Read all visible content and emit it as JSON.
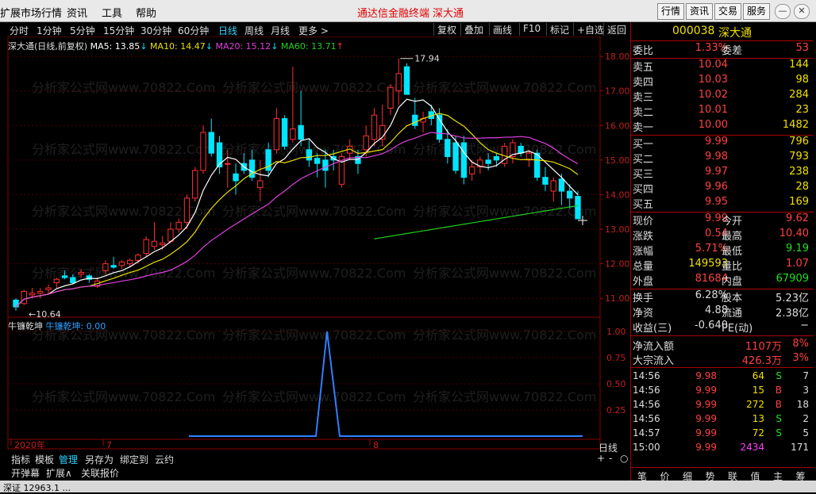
{
  "menu": {
    "items": [
      "扩展市场行情",
      "资讯",
      "工具",
      "帮助"
    ],
    "brand": "通达信金融终端",
    "stock": "深大通",
    "buttons": [
      "行情",
      "资讯",
      "交易",
      "服务"
    ]
  },
  "toolbar": {
    "periods": [
      "分时",
      "1分钟",
      "5分钟",
      "15分钟",
      "30分钟",
      "60分钟",
      "日线",
      "周线",
      "月线",
      "更多 >"
    ],
    "active": "日线",
    "right": [
      "复权",
      "叠加",
      "画线",
      "F10",
      "标记",
      "+自选",
      "返回"
    ]
  },
  "legend": {
    "name": "深大通(日线,前复权)",
    "ma5": "MA5: 13.85",
    "ma10": "MA10: 14.47",
    "ma20": "MA20: 15.12",
    "ma60": "MA60: 13.71"
  },
  "indicator": {
    "name": "牛镰乾坤",
    "label": "牛镰乾坤: 0.00"
  },
  "axis": {
    "period": "日线",
    "date_left": "2020年",
    "date_m1": "7",
    "date_m2": "8"
  },
  "watermark": "分析家公式网www.70822.Com",
  "bottom_tabs": [
    "指标",
    "模板",
    "管理",
    "另存为",
    "绑定到",
    "云约"
  ],
  "bottom_tabs2": [
    "开弹幕",
    "扩展∧",
    "关联报价"
  ],
  "zoom": [
    "+",
    "-",
    "○"
  ],
  "colors": {
    "up": "#ff3030",
    "down": "#00e5ff",
    "ma5": "#ffffff",
    "ma10": "#e8e000",
    "ma20": "#e040e0",
    "ma60": "#20d020",
    "ind": "#2f7fff"
  },
  "chart_data": {
    "type": "candlestick",
    "ylim": [
      10.5,
      18.3
    ],
    "y_ticks": [
      11.0,
      12.0,
      13.0,
      14.0,
      15.0,
      16.0,
      17.0,
      18.0
    ],
    "ind_ticks": [
      0.25,
      0.5,
      0.75,
      1.0
    ],
    "annotations": {
      "high": "17.94",
      "low": "10.64"
    },
    "candles": [
      [
        10.95,
        11.0,
        10.64,
        10.75
      ],
      [
        10.85,
        11.25,
        10.8,
        11.2
      ],
      [
        11.1,
        11.3,
        11.0,
        11.15
      ],
      [
        11.15,
        11.3,
        11.0,
        11.2
      ],
      [
        11.25,
        11.4,
        11.1,
        11.3
      ],
      [
        11.45,
        11.6,
        11.3,
        11.55
      ],
      [
        11.65,
        11.8,
        11.55,
        11.6
      ],
      [
        11.6,
        11.7,
        11.4,
        11.45
      ],
      [
        11.7,
        11.85,
        11.6,
        11.75
      ],
      [
        11.65,
        11.7,
        11.45,
        11.55
      ],
      [
        11.35,
        11.6,
        11.3,
        11.5
      ],
      [
        11.8,
        12.1,
        11.7,
        12.0
      ],
      [
        11.95,
        12.2,
        11.85,
        11.9
      ],
      [
        11.95,
        12.1,
        11.85,
        12.05
      ],
      [
        12.0,
        12.15,
        11.9,
        12.1
      ],
      [
        12.1,
        12.3,
        12.0,
        12.25
      ],
      [
        12.3,
        12.8,
        12.2,
        12.7
      ],
      [
        12.5,
        13.2,
        12.4,
        12.65
      ],
      [
        12.55,
        12.8,
        12.4,
        12.6
      ],
      [
        12.65,
        13.2,
        12.6,
        13.0
      ],
      [
        13.0,
        13.3,
        12.9,
        13.2
      ],
      [
        13.2,
        14.0,
        13.0,
        13.9
      ],
      [
        13.9,
        14.8,
        13.8,
        14.7
      ],
      [
        14.7,
        16.0,
        14.6,
        15.8
      ],
      [
        15.8,
        16.2,
        15.1,
        15.2
      ],
      [
        15.5,
        15.7,
        14.6,
        14.8
      ],
      [
        14.9,
        15.3,
        14.2,
        14.9
      ],
      [
        14.6,
        14.9,
        14.0,
        14.4
      ],
      [
        14.9,
        15.2,
        14.6,
        14.7
      ],
      [
        15.0,
        15.3,
        14.4,
        14.5
      ],
      [
        14.2,
        15.0,
        13.8,
        14.4
      ],
      [
        15.3,
        15.5,
        14.5,
        14.7
      ],
      [
        15.3,
        16.5,
        15.2,
        16.2
      ],
      [
        16.2,
        16.3,
        15.3,
        15.4
      ],
      [
        15.6,
        17.7,
        15.5,
        15.9
      ],
      [
        16.0,
        17.0,
        15.4,
        15.6
      ],
      [
        15.3,
        15.6,
        14.8,
        15.0
      ],
      [
        15.05,
        15.2,
        14.5,
        14.9
      ],
      [
        15.0,
        15.3,
        14.2,
        14.7
      ],
      [
        15.1,
        15.3,
        14.7,
        15.0
      ],
      [
        14.3,
        15.2,
        14.2,
        15.1
      ],
      [
        15.2,
        15.6,
        15.0,
        15.4
      ],
      [
        15.1,
        15.3,
        14.6,
        14.9
      ],
      [
        15.3,
        16.0,
        15.1,
        15.7
      ],
      [
        15.6,
        16.5,
        15.4,
        16.3
      ],
      [
        15.6,
        16.6,
        15.4,
        16.0
      ],
      [
        16.5,
        17.2,
        16.3,
        17.1
      ],
      [
        17.0,
        17.94,
        16.6,
        17.5
      ],
      [
        17.7,
        17.8,
        16.9,
        16.9
      ],
      [
        16.3,
        16.8,
        15.9,
        16.0
      ],
      [
        16.1,
        16.4,
        15.8,
        16.2
      ],
      [
        16.4,
        16.6,
        16.0,
        16.2
      ],
      [
        16.3,
        16.5,
        15.5,
        15.6
      ],
      [
        15.6,
        15.9,
        14.9,
        15.1
      ],
      [
        15.5,
        15.7,
        14.6,
        14.7
      ],
      [
        15.5,
        15.7,
        14.3,
        14.5
      ],
      [
        14.6,
        15.0,
        14.4,
        14.8
      ],
      [
        14.8,
        15.1,
        14.6,
        15.0
      ],
      [
        15.0,
        15.2,
        14.7,
        14.9
      ],
      [
        15.1,
        15.2,
        14.8,
        15.0
      ],
      [
        14.9,
        15.5,
        14.8,
        15.4
      ],
      [
        15.1,
        15.6,
        14.9,
        15.5
      ],
      [
        15.4,
        15.5,
        15.1,
        15.2
      ],
      [
        15.0,
        15.3,
        14.8,
        15.2
      ],
      [
        15.2,
        15.3,
        14.4,
        14.5
      ],
      [
        14.5,
        14.8,
        14.1,
        14.3
      ],
      [
        14.1,
        14.5,
        13.8,
        14.4
      ],
      [
        14.45,
        14.6,
        13.7,
        14.1
      ],
      [
        14.1,
        14.3,
        13.6,
        13.9
      ],
      [
        13.95,
        14.1,
        13.3,
        13.3
      ]
    ],
    "ma5_start": 0,
    "ma10_start": 0,
    "ma20_start": 0,
    "ma60_start": 44
  },
  "panel": {
    "code": "000038",
    "name": "深大通",
    "weibi": {
      "l": "委比",
      "v": "1.33%",
      "l2": "委差",
      "v2": "53"
    },
    "sells": [
      {
        "l": "卖五",
        "p": "10.04",
        "q": "144"
      },
      {
        "l": "卖四",
        "p": "10.03",
        "q": "98"
      },
      {
        "l": "卖三",
        "p": "10.02",
        "q": "284"
      },
      {
        "l": "卖二",
        "p": "10.01",
        "q": "23"
      },
      {
        "l": "卖一",
        "p": "10.00",
        "q": "1482"
      }
    ],
    "buys": [
      {
        "l": "买一",
        "p": "9.99",
        "q": "796"
      },
      {
        "l": "买二",
        "p": "9.98",
        "q": "793"
      },
      {
        "l": "买三",
        "p": "9.97",
        "q": "238"
      },
      {
        "l": "买四",
        "p": "9.96",
        "q": "28"
      },
      {
        "l": "买五",
        "p": "9.95",
        "q": "169"
      }
    ],
    "stats": [
      {
        "l": "现价",
        "v": "9.99",
        "l2": "今开",
        "v2": "9.62"
      },
      {
        "l": "涨跌",
        "v": "0.54",
        "l2": "最高",
        "v2": "10.40"
      },
      {
        "l": "涨幅",
        "v": "5.71%",
        "l2": "最低",
        "v2": "9.19"
      },
      {
        "l": "总量",
        "v": "149593",
        "l2": "量比",
        "v2": "1.07"
      },
      {
        "l": "外盘",
        "v": "81684",
        "l2": "内盘",
        "v2": "67909"
      }
    ],
    "stats2": [
      {
        "l": "换手",
        "v": "6.28%",
        "l2": "股本",
        "v2": "5.23亿"
      },
      {
        "l": "净资",
        "v": "4.88",
        "l2": "流通",
        "v2": "2.38亿"
      },
      {
        "l": "收益(三)",
        "v": "-0.640",
        "l2": "PE(动)",
        "v2": "−"
      }
    ],
    "flow": [
      {
        "l": "净流入额",
        "v": "1107万",
        "p": "8%"
      },
      {
        "l": "大宗流入",
        "v": "426.3万",
        "p": "3%"
      }
    ],
    "ticks": [
      {
        "t": "14:56",
        "p": "9.98",
        "q": "64",
        "d": "S",
        "n": "7"
      },
      {
        "t": "14:56",
        "p": "9.99",
        "q": "15",
        "d": "B",
        "n": "3"
      },
      {
        "t": "14:56",
        "p": "9.99",
        "q": "272",
        "d": "B",
        "n": "18"
      },
      {
        "t": "14:56",
        "p": "9.99",
        "q": "13",
        "d": "S",
        "n": "2"
      },
      {
        "t": "14:57",
        "p": "9.99",
        "q": "72",
        "d": "S",
        "n": "5"
      },
      {
        "t": "15:00",
        "p": "9.99",
        "q": "2434",
        "d": "",
        "n": "171"
      }
    ],
    "tabs": [
      "笔",
      "价",
      "细",
      "势",
      "联",
      "值",
      "主",
      "筹"
    ]
  },
  "status": "深证 12963.1 ..."
}
